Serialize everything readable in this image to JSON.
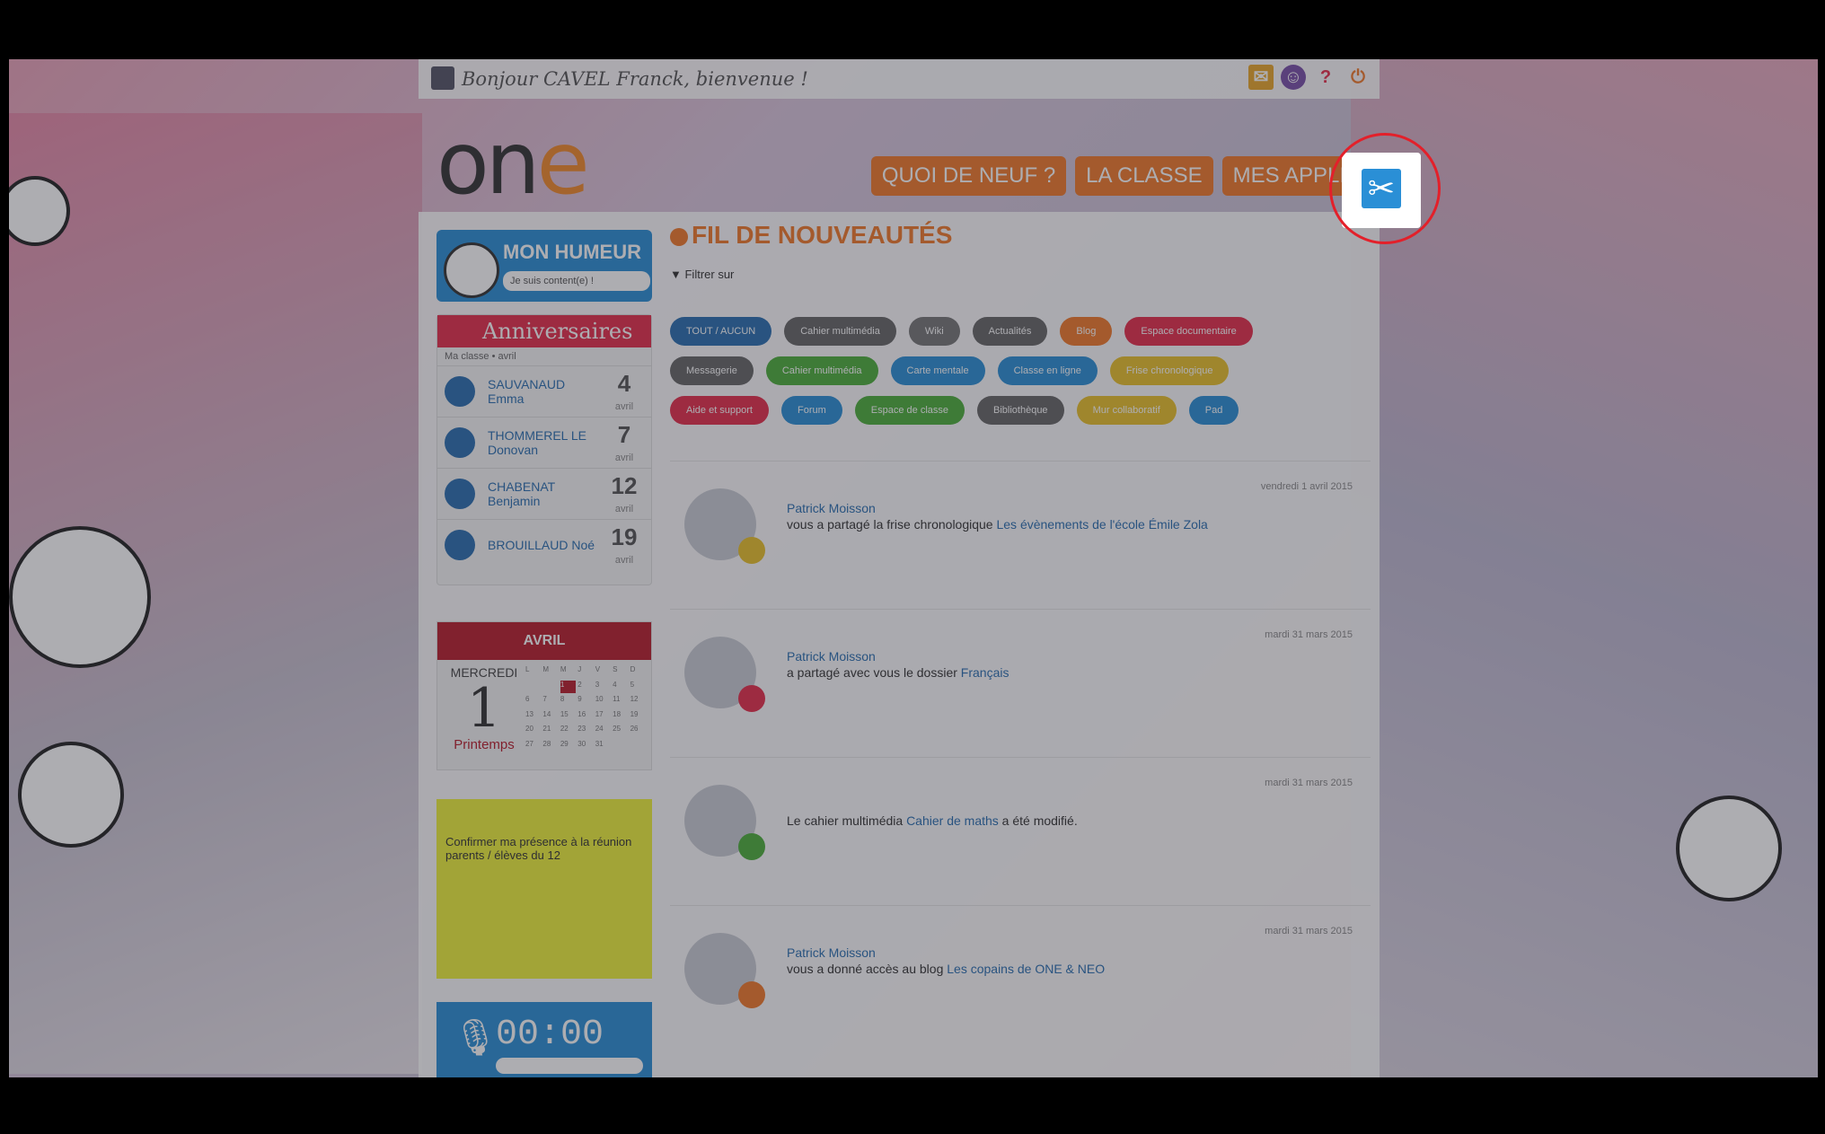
{
  "topbar": {
    "greeting": "Bonjour CAVEL Franck, bienvenue !"
  },
  "logo": {
    "text_main": "on",
    "text_accent": "e"
  },
  "nav": {
    "items": [
      {
        "label": "QUOI DE NEUF ?"
      },
      {
        "label": "LA CLASSE"
      },
      {
        "label": "MES APPLIS"
      }
    ]
  },
  "humeur": {
    "title": "MON HUMEUR",
    "select_value": "Je suis content(e) !"
  },
  "anniversaires": {
    "title": "Anniversaires",
    "subtitle": "Ma classe  •  avril",
    "rows": [
      {
        "name": "SAUVANAUD Emma",
        "day": "4",
        "month": "avril"
      },
      {
        "name": "THOMMEREL LE Donovan",
        "day": "7",
        "month": "avril"
      },
      {
        "name": "CHABENAT Benjamin",
        "day": "12",
        "month": "avril"
      },
      {
        "name": "BROUILLAUD Noé",
        "day": "19",
        "month": "avril"
      }
    ]
  },
  "calendar": {
    "month": "AVRIL",
    "weekday": "MERCREDI",
    "day": "1",
    "season": "Printemps",
    "grid_headers": [
      "L",
      "M",
      "M",
      "J",
      "V",
      "S",
      "D"
    ],
    "grid_days": [
      "",
      "",
      "1",
      "2",
      "3",
      "4",
      "5",
      "6",
      "7",
      "8",
      "9",
      "10",
      "11",
      "12",
      "13",
      "14",
      "15",
      "16",
      "17",
      "18",
      "19",
      "20",
      "21",
      "22",
      "23",
      "24",
      "25",
      "26",
      "27",
      "28",
      "29",
      "30",
      "31"
    ]
  },
  "postit": {
    "text": "Confirmer ma présence à la réunion parents / élèves du 12"
  },
  "recorder": {
    "time": "00:00"
  },
  "feed": {
    "title": "FIL DE NOUVEAUTÉS",
    "filter_label": "Filtrer sur",
    "pills": [
      {
        "label": "TOUT / AUCUN",
        "color": "#2a6fb0"
      },
      {
        "label": "Cahier multimédia",
        "color": "#666666"
      },
      {
        "label": "Wiki",
        "color": "#777777"
      },
      {
        "label": "Actualités",
        "color": "#666666"
      },
      {
        "label": "Blog",
        "color": "#f07a2a"
      },
      {
        "label": "Espace documentaire",
        "color": "#e52e4b"
      },
      {
        "label": "Messagerie",
        "color": "#666666"
      },
      {
        "label": "Cahier multimédia",
        "color": "#4caf3a"
      },
      {
        "label": "Carte mentale",
        "color": "#2a8fd6"
      },
      {
        "label": "Classe en ligne",
        "color": "#2a8fd6"
      },
      {
        "label": "Frise chronologique",
        "color": "#e8c12a"
      },
      {
        "label": "Aide et support",
        "color": "#e52e4b"
      },
      {
        "label": "Forum",
        "color": "#2a8fd6"
      },
      {
        "label": "Espace de classe",
        "color": "#4caf3a"
      },
      {
        "label": "Bibliothèque",
        "color": "#666666"
      },
      {
        "label": "Mur collaboratif",
        "color": "#e8c12a"
      },
      {
        "label": "Pad",
        "color": "#2a8fd6"
      }
    ],
    "items": [
      {
        "author": "Patrick Moisson",
        "text": "vous a partagé la frise chronologique",
        "link": "Les évènements de l'école Émile Zola",
        "date": "vendredi 1 avril 2015",
        "badge_color": "#e8c12a"
      },
      {
        "author": "Patrick Moisson",
        "text": "a partagé avec vous le dossier",
        "link": "Français",
        "date": "mardi 31 mars 2015",
        "badge_color": "#e52e4b"
      },
      {
        "author": "",
        "text": "Le cahier multimédia",
        "link": "Cahier de maths",
        "text2": "a été modifié.",
        "date": "mardi 31 mars 2015",
        "badge_color": "#4caf3a"
      },
      {
        "author": "Patrick Moisson",
        "text": "vous a donné accès au blog",
        "link": "Les copains de ONE & NEO",
        "date": "mardi 31 mars 2015",
        "badge_color": "#f07a2a"
      }
    ]
  },
  "tool_icon": "tools-icon",
  "colors": {
    "accent_orange": "#f07a2a",
    "accent_blue": "#2a8fd6",
    "highlight_ring": "#e3202a"
  }
}
